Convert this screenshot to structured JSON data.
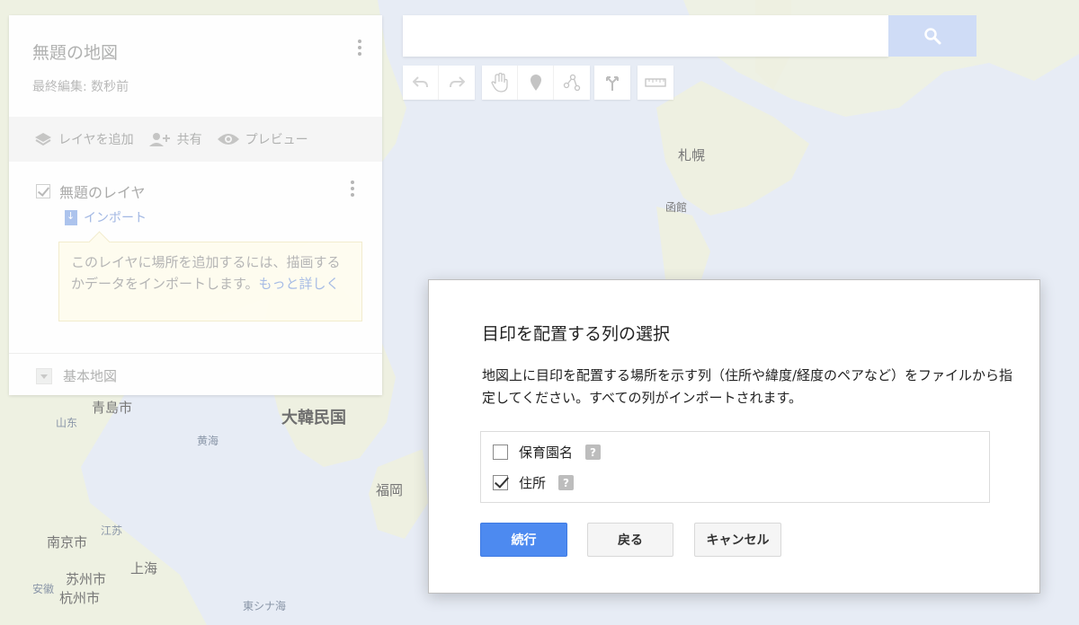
{
  "panel": {
    "title": "無題の地図",
    "last_edited": "最終編集: 数秒前",
    "actions": {
      "add_layer": "レイヤを追加",
      "share": "共有",
      "preview": "プレビュー"
    },
    "layer_name": "無題のレイヤ",
    "import_label": "インポート",
    "tooltip_text": "このレイヤに場所を追加するには、描画するかデータをインポートします。",
    "tooltip_more": "もっと詳しく",
    "basemap_label": "基本地図"
  },
  "search": {
    "value": ""
  },
  "map_labels": {
    "sapporo": "札幌",
    "hakodate": "函館",
    "korea": "大韓民国",
    "qingdao": "青島市",
    "shandong": "山东",
    "yellow_sea": "黄海",
    "fukuoka": "福岡",
    "jiangsu": "江苏",
    "nanjing": "南京市",
    "suzhou": "苏州市",
    "shanghai": "上海",
    "anhui": "安徽",
    "hangzhou": "杭州市",
    "east_china_sea": "東シナ海"
  },
  "dialog": {
    "title": "目印を配置する列の選択",
    "description": "地図上に目印を配置する場所を示す列（住所や緯度/経度のペアなど）をファイルから指定してください。すべての列がインポートされます。",
    "columns": [
      {
        "label": "保育園名",
        "checked": false,
        "help": "?"
      },
      {
        "label": "住所",
        "checked": true,
        "help": "?"
      }
    ],
    "buttons": {
      "continue": "続行",
      "back": "戻る",
      "cancel": "キャンセル"
    }
  },
  "colors": {
    "primary": "#4d8af0",
    "water": "#e7ecf5",
    "land": "#eef1e4"
  }
}
